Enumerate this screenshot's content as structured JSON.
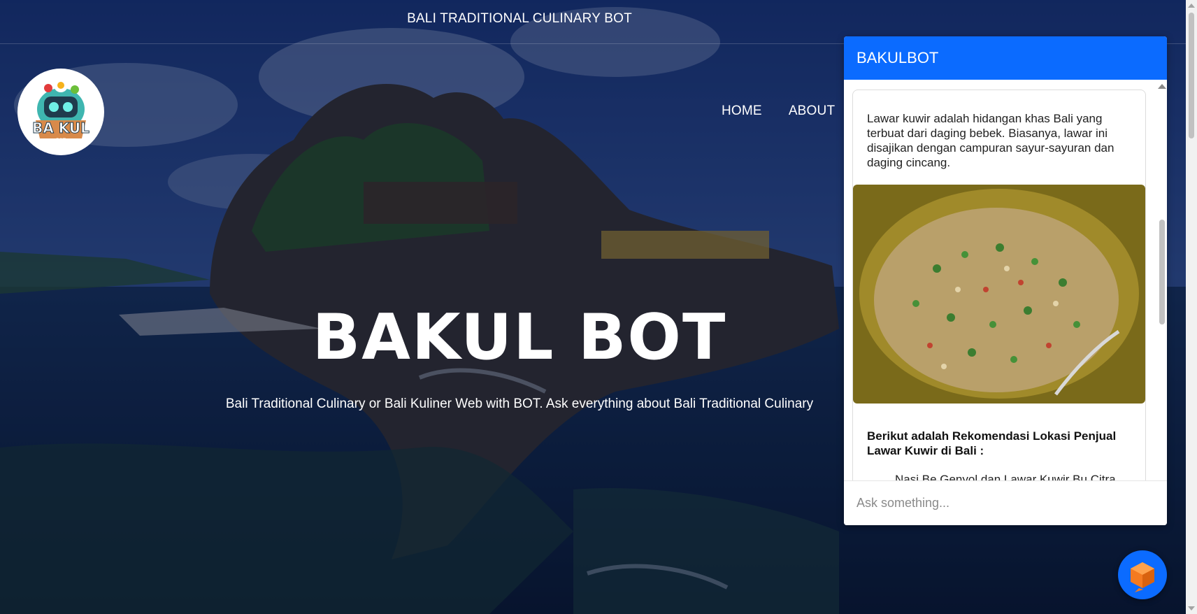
{
  "header": {
    "title": "BALI TRADITIONAL CULINARY BOT"
  },
  "logo": {
    "text": "BA KUL",
    "small": "BOT"
  },
  "nav": {
    "items": [
      {
        "label": "HOME"
      },
      {
        "label": "ABOUT"
      }
    ]
  },
  "hero": {
    "title": "BAKUL BOT",
    "subtitle": "Bali Traditional Culinary or Bali Kuliner Web with BOT. Ask everything about Bali Traditional Culinary"
  },
  "chat": {
    "title": "BAKULBOT",
    "message": "Lawar kuwir adalah hidangan khas Bali yang terbuat dari daging bebek. Biasanya, lawar ini disajikan dengan campuran sayur-sayuran dan daging cincang.",
    "recommendation_title": "Berikut adalah Rekomendasi Lokasi Penjual Lawar Kuwir di Bali :",
    "recommendation_items": [
      "Nasi Be Genyol dan Lawar Kuwir Bu Citra"
    ],
    "input_placeholder": "Ask something...",
    "accent": "#0b6bff"
  },
  "launcher": {
    "icon": "cube-icon"
  }
}
